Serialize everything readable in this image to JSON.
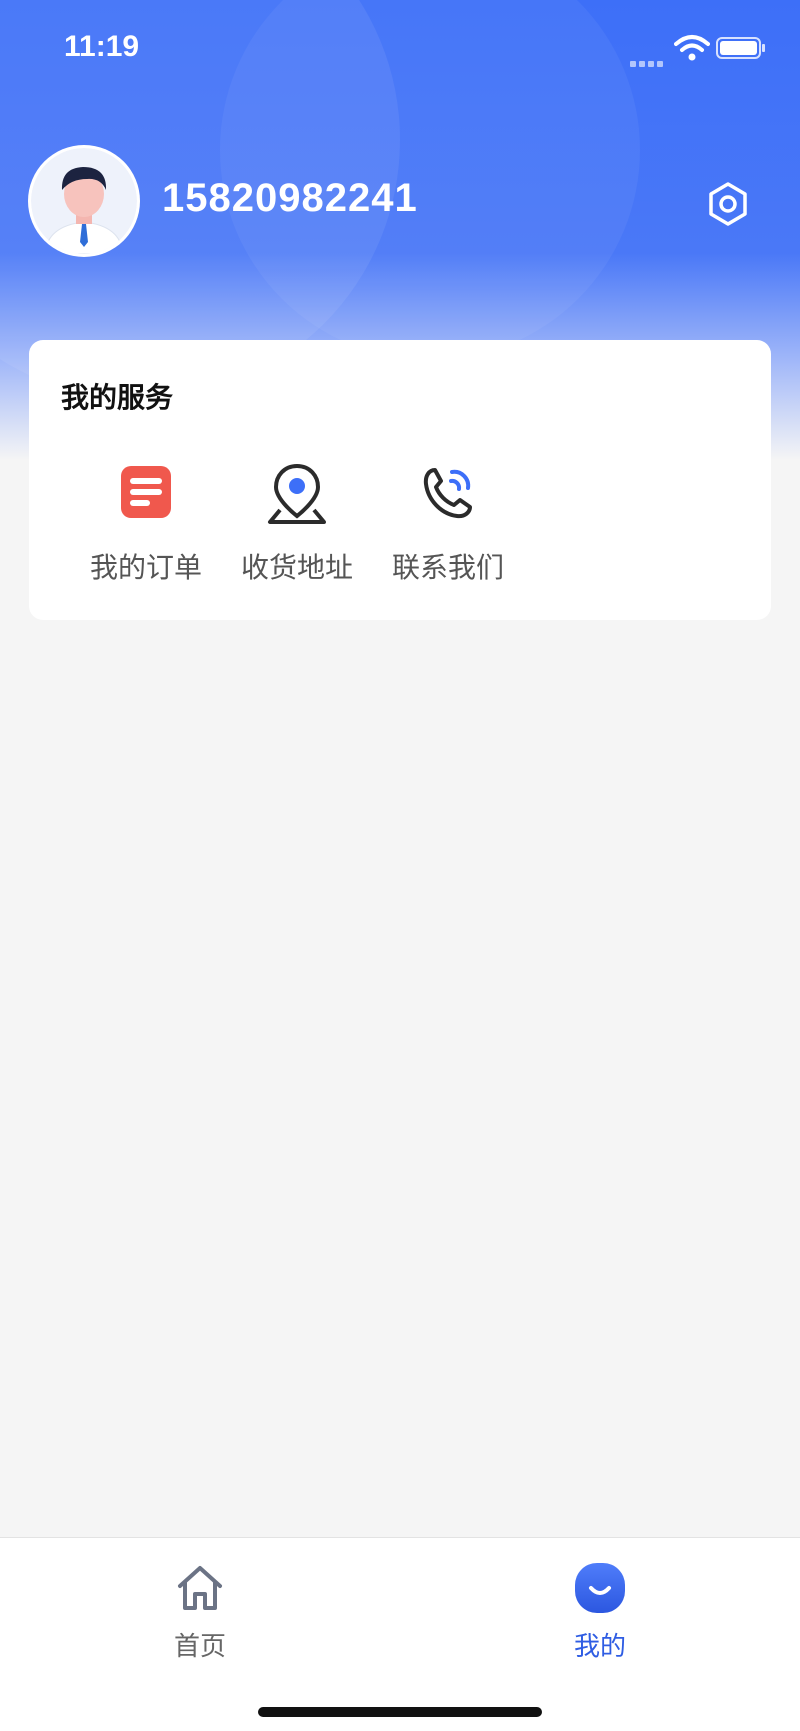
{
  "status_bar": {
    "time": "11:19"
  },
  "profile": {
    "phone": "15820982241"
  },
  "services": {
    "title": "我的服务",
    "items": [
      {
        "label": "我的订单",
        "icon": "order-list-icon"
      },
      {
        "label": "收货地址",
        "icon": "location-pin-icon"
      },
      {
        "label": "联系我们",
        "icon": "phone-call-icon"
      }
    ]
  },
  "tabbar": {
    "items": [
      {
        "label": "首页",
        "icon": "home-icon",
        "active": false
      },
      {
        "label": "我的",
        "icon": "smile-icon",
        "active": true
      }
    ]
  },
  "colors": {
    "brand": "#3d6ff8",
    "active_tab": "#2f5de3",
    "inactive_tab": "#666666",
    "order_icon": "#f0584d"
  }
}
